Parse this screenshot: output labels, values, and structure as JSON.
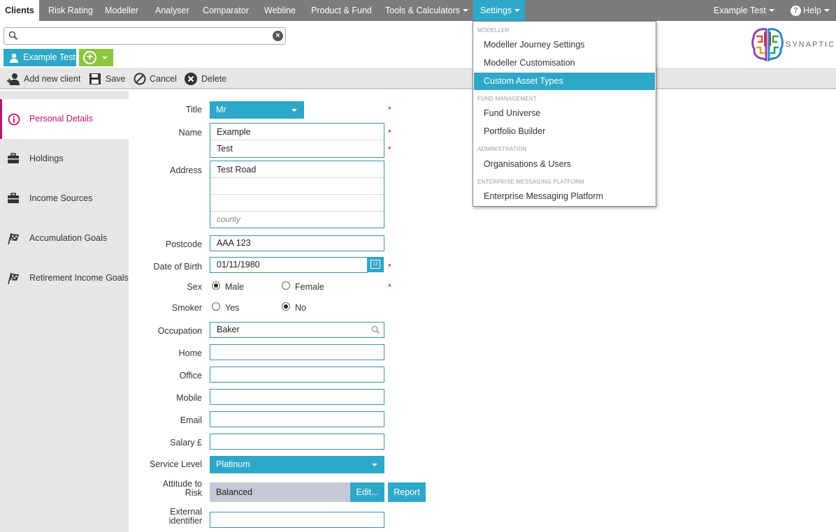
{
  "nav": {
    "tabs": [
      "Clients",
      "Risk Rating",
      "Modeller",
      "Analyser",
      "Comparator",
      "Webline",
      "Product & Fund",
      "Tools & Calculators",
      "Settings"
    ],
    "user": "Example Test",
    "help": "Help"
  },
  "search": {
    "value": ""
  },
  "client": {
    "chip": "Example Test"
  },
  "logo": {
    "text": "SYNAPTIC"
  },
  "toolbar": {
    "add": "Add new client",
    "save": "Save",
    "cancel": "Cancel",
    "delete": "Delete"
  },
  "sidebar": {
    "items": [
      "Personal Details",
      "Holdings",
      "Income Sources",
      "Accumulation Goals",
      "Retirement Income Goals"
    ]
  },
  "form": {
    "title_label": "Title",
    "title_value": "Mr",
    "name_label": "Name",
    "first_name": "Example",
    "last_name": "Test",
    "address_label": "Address",
    "address1": "Test Road",
    "address2": "",
    "address3": "",
    "county_placeholder": "county",
    "postcode_label": "Postcode",
    "postcode": "AAA 123",
    "dob_label": "Date of Birth",
    "dob": "01/11/1980",
    "cal_day": "12",
    "sex_label": "Sex",
    "sex_male": "Male",
    "sex_female": "Female",
    "smoker_label": "Smoker",
    "smoker_yes": "Yes",
    "smoker_no": "No",
    "occupation_label": "Occupation",
    "occupation": "Baker",
    "home_label": "Home",
    "home": "",
    "office_label": "Office",
    "office": "",
    "mobile_label": "Mobile",
    "mobile": "",
    "email_label": "Email",
    "email": "",
    "salary_label": "Salary £",
    "salary": "",
    "service_label": "Service Level",
    "service": "Platinum",
    "atr_label_1": "Attitude to",
    "atr_label_2": "Risk",
    "atr": "Balanced",
    "edit_btn": "Edit...",
    "report_btn": "Report",
    "ext_label_1": "External",
    "ext_label_2": "identifier",
    "ext": "",
    "req": "*"
  },
  "menu": {
    "h1": "MODELLER",
    "i1": "Modeller Journey Settings",
    "i2": "Modeller Customisation",
    "i3": "Custom Asset Types",
    "h2": "FUND MANAGEMENT",
    "i4": "Fund Universe",
    "i5": "Portfolio Builder",
    "h3": "ADMINISTRATION",
    "i6": "Organisations & Users",
    "h4": "ENTERPRISE MESSAGING PLATFORM",
    "i7": "Enterprise Messaging Platform"
  },
  "colors": {
    "accent": "#2ea8c8",
    "nav": "#7c7c7c",
    "green": "#8cc63f",
    "active_side": "#c0136a"
  }
}
